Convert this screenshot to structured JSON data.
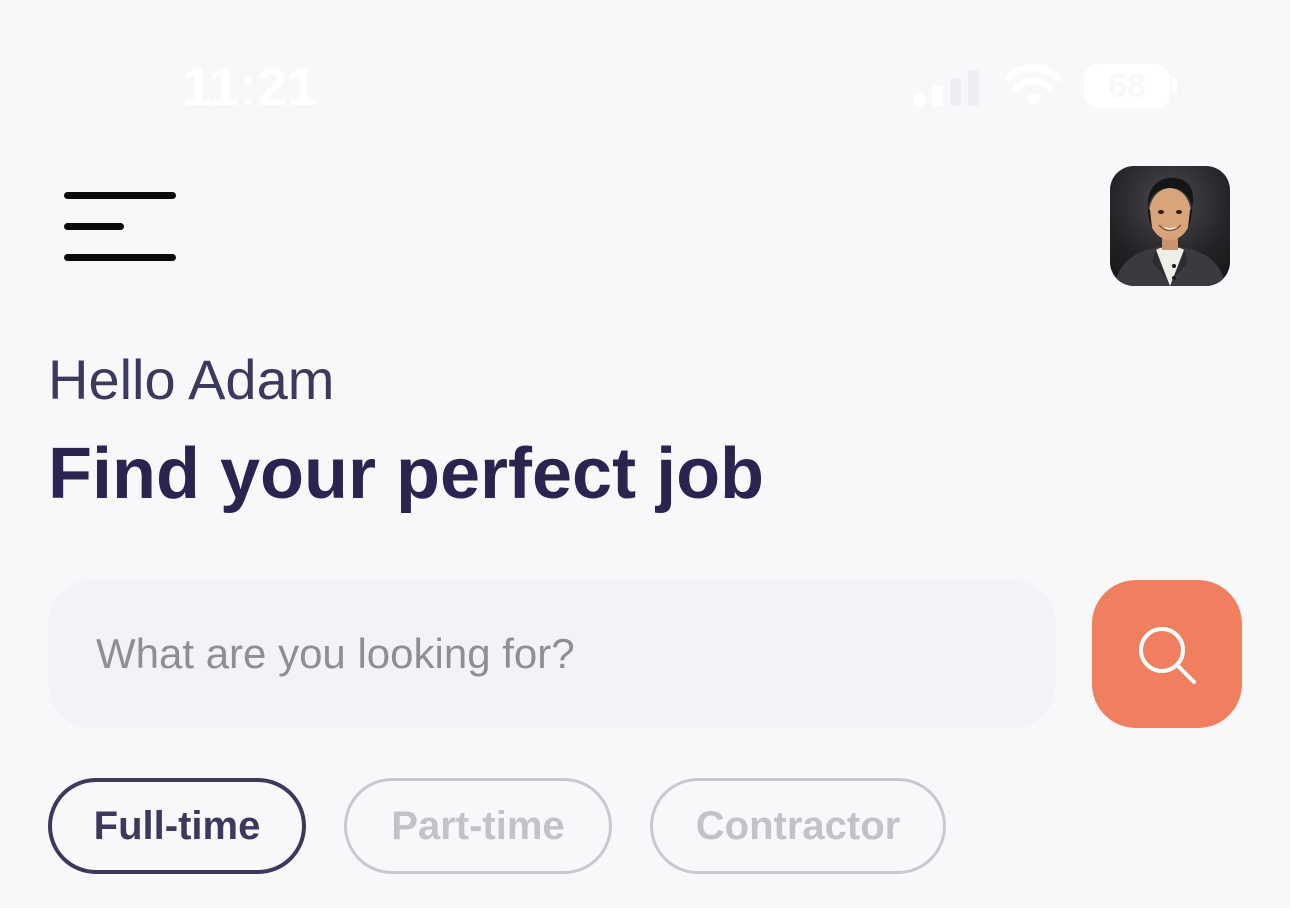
{
  "status_bar": {
    "time": "11:21",
    "battery": "68",
    "signal_icon": "cellular-signal-icon",
    "wifi_icon": "wifi-icon"
  },
  "header": {
    "menu_icon": "hamburger-menu-icon",
    "avatar": "user-avatar-photo"
  },
  "greeting": {
    "hello": "Hello Adam",
    "title": "Find your perfect job"
  },
  "search": {
    "placeholder": "What are you looking for?",
    "value": "",
    "button_icon": "search-icon"
  },
  "filters": [
    {
      "label": "Full-time",
      "selected": true
    },
    {
      "label": "Part-time",
      "selected": false
    },
    {
      "label": "Contractor",
      "selected": false
    }
  ],
  "colors": {
    "background": "#F8F8FB",
    "primary_text": "#2A2550",
    "accent": "#EF7F5E",
    "chip_active_border": "#3C3A5C",
    "chip_inactive_border": "#C8C8CE"
  }
}
